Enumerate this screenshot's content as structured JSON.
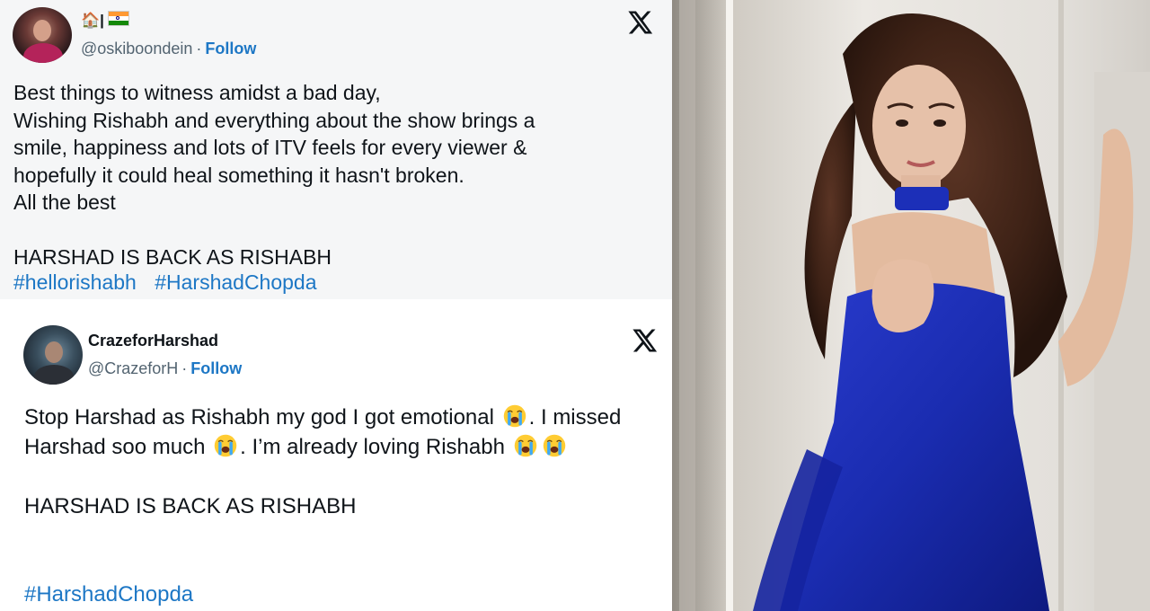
{
  "tweet1": {
    "display_name": "🏠|",
    "handle": "@oskiboondein",
    "separator": "·",
    "follow_label": "Follow",
    "body_lines": [
      "Best things to witness amidst a bad day,",
      "Wishing Rishabh and everything about the show brings a",
      "smile, happiness and lots of ITV feels for every viewer &",
      "hopefully it could heal something it hasn't broken.",
      "All the best",
      "",
      "HARSHAD IS BACK AS RISHABH"
    ],
    "hashtags": [
      "#hellorishabh",
      "#HarshadChopda"
    ]
  },
  "tweet2": {
    "display_name": "CrazeforHarshad",
    "handle": "@CrazeforH",
    "separator": "·",
    "follow_label": "Follow",
    "body_part1": "Stop Harshad as Rishabh my god I got emotional ",
    "body_part2": ". I missed Harshad soo much ",
    "body_part3": ". I’m already loving Rishabh ",
    "body_part4": "HARSHAD IS BACK AS RISHABH",
    "hashtag": "#HarshadChopda"
  },
  "icons": {
    "platform_logo": "x-logo-icon",
    "emoji": "loudly-crying-face-icon",
    "flag": "india-flag-icon"
  },
  "colors": {
    "link": "#1d77c5",
    "text": "#0f1419",
    "muted": "#536471",
    "tweet1_bg": "#f5f6f7",
    "dress": "#1c2fb8"
  }
}
